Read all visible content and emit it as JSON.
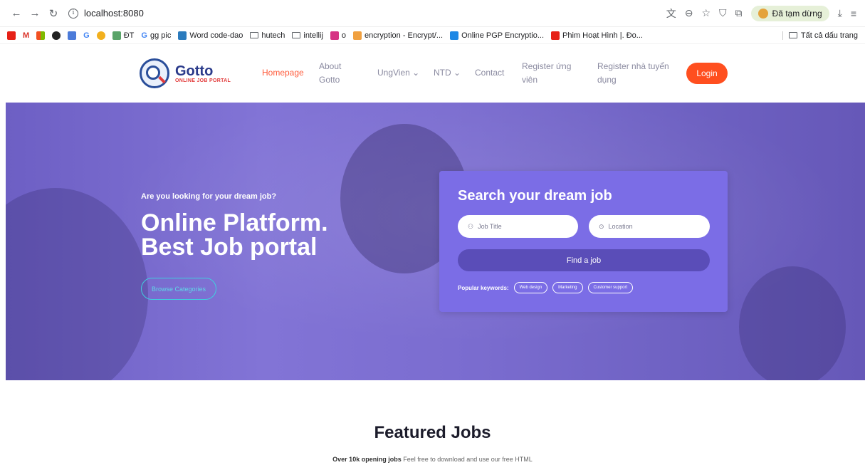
{
  "browser": {
    "url": "localhost:8080",
    "profile_status": "Đã tạm dừng",
    "bookmarks": [
      "ĐT",
      "gg pic",
      "Word code-dao",
      "hutech",
      "intellij",
      "o",
      "encryption - Encrypt/...",
      "Online PGP Encryptio...",
      "Phim Hoạt Hình |. Đo..."
    ],
    "bookmarks_right": "Tất cả dấu trang"
  },
  "site": {
    "brand": "Gotto",
    "brand_sub": "ONLINE JOB PORTAL",
    "nav": {
      "homepage": "Homepage",
      "about_1": "About",
      "about_2": "Gotto",
      "ungvien": "UngVien ⌄",
      "ntd": "NTD ⌄",
      "contact": "Contact",
      "reg_uv_1": "Register ứng",
      "reg_uv_2": "viên",
      "reg_ntd_1": "Register nhà tuyển",
      "reg_ntd_2": "dụng",
      "login": "Login"
    }
  },
  "hero": {
    "pre": "Are you looking for your dream job?",
    "title_1": "Online Platform.",
    "title_2": "Best Job portal",
    "browse": "Browse Categories"
  },
  "search": {
    "heading": "Search your dream job",
    "job_placeholder": "Job Title",
    "location_placeholder": "Location",
    "find": "Find a job",
    "popular_label": "Popular keywords:",
    "keywords": [
      "Web design",
      "Marketing",
      "Customer support"
    ]
  },
  "featured": {
    "title": "Featured Jobs",
    "sub_bold": "Over 10k opening jobs",
    "sub_rest": " Feel free to download and use our free HTML"
  },
  "colors": {
    "accent": "#ff5b3b",
    "hero": "#7a6ccf",
    "search_card": "#7b6de6",
    "login": "#ff4f1f"
  }
}
